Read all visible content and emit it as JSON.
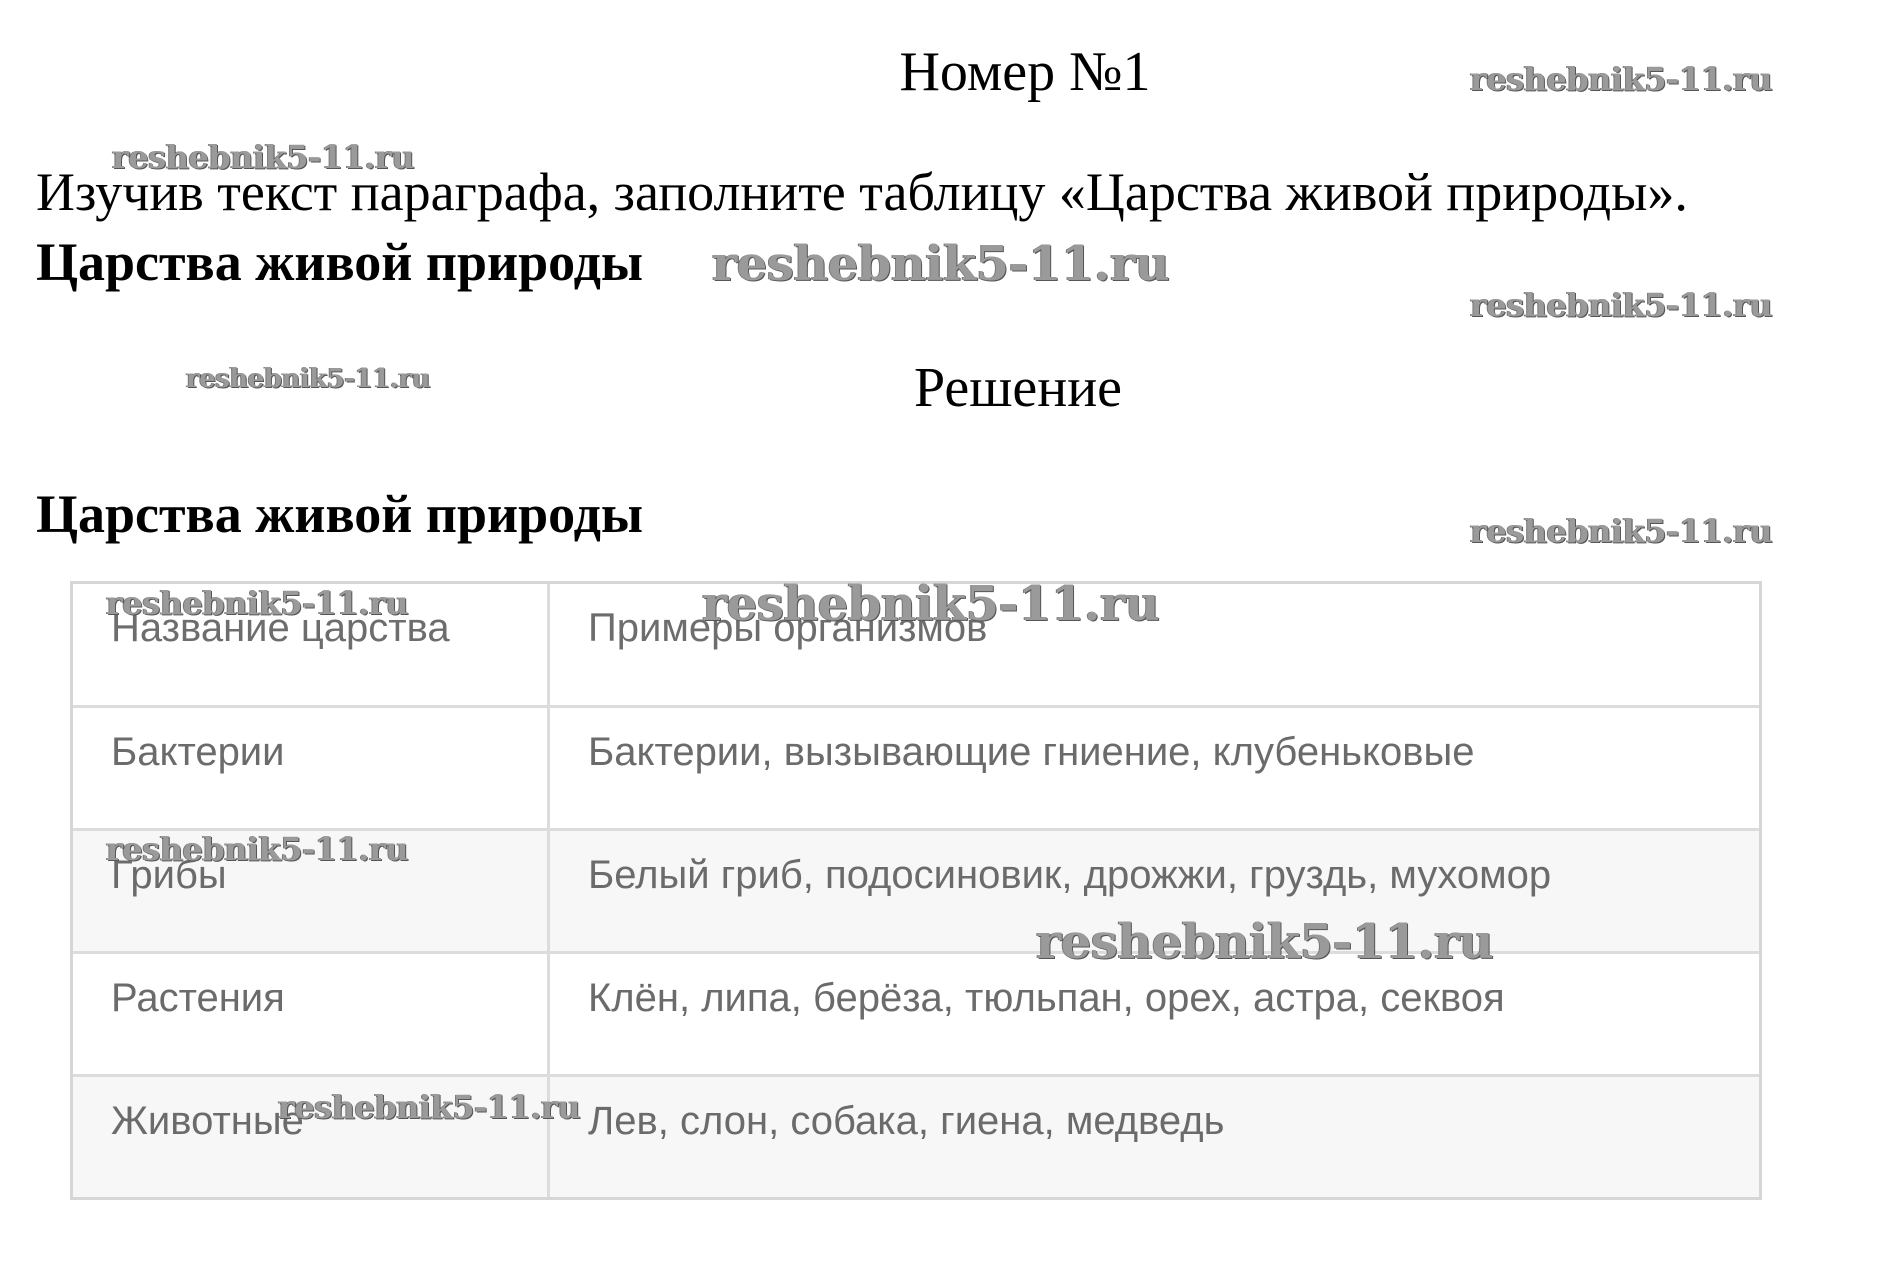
{
  "header": {
    "title": "Номер №1",
    "task": "Изучив текст параграфа, заполните таблицу «Царства живой природы».",
    "task_heading": "Царства живой природы"
  },
  "solution": {
    "title": "Решение",
    "heading": "Царства живой природы"
  },
  "table": {
    "columns": [
      "Название царства",
      "Примеры организмов"
    ],
    "rows": [
      [
        "Бактерии",
        "Бактерии, вызывающие гниение, клубеньковые"
      ],
      [
        "Грибы",
        "Белый гриб, подосиновик, дрожжи, груздь, мухомор"
      ],
      [
        "Растения",
        "Клён, липа, берёза, тюльпан, орех, астра, секвоя"
      ],
      [
        "Животные",
        "Лев, слон, собака, гиена, медведь"
      ]
    ]
  },
  "watermark": "reshebnik5-11.ru"
}
